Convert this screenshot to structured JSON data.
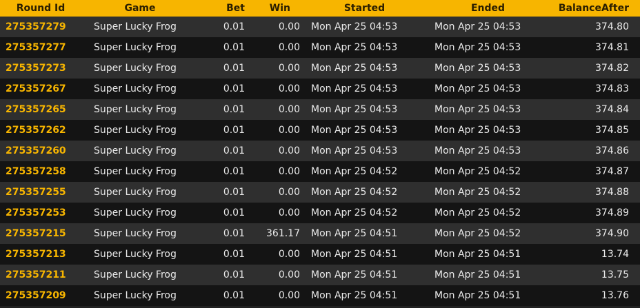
{
  "headers": {
    "round_id": "Round Id",
    "game": "Game",
    "bet": "Bet",
    "win": "Win",
    "started": "Started",
    "ended": "Ended",
    "balance_after": "BalanceAfter"
  },
  "colors": {
    "header_bg": "#f7b500",
    "round_id_text": "#f7b500",
    "row_light": "#2f2f2f",
    "row_dark": "#141414",
    "text": "#eaeaea"
  },
  "rows": [
    {
      "round_id": "275357279",
      "game": "Super Lucky Frog",
      "bet": "0.01",
      "win": "0.00",
      "started": "Mon Apr 25 04:53",
      "ended": "Mon Apr 25 04:53",
      "balance_after": "374.80"
    },
    {
      "round_id": "275357277",
      "game": "Super Lucky Frog",
      "bet": "0.01",
      "win": "0.00",
      "started": "Mon Apr 25 04:53",
      "ended": "Mon Apr 25 04:53",
      "balance_after": "374.81"
    },
    {
      "round_id": "275357273",
      "game": "Super Lucky Frog",
      "bet": "0.01",
      "win": "0.00",
      "started": "Mon Apr 25 04:53",
      "ended": "Mon Apr 25 04:53",
      "balance_after": "374.82"
    },
    {
      "round_id": "275357267",
      "game": "Super Lucky Frog",
      "bet": "0.01",
      "win": "0.00",
      "started": "Mon Apr 25 04:53",
      "ended": "Mon Apr 25 04:53",
      "balance_after": "374.83"
    },
    {
      "round_id": "275357265",
      "game": "Super Lucky Frog",
      "bet": "0.01",
      "win": "0.00",
      "started": "Mon Apr 25 04:53",
      "ended": "Mon Apr 25 04:53",
      "balance_after": "374.84"
    },
    {
      "round_id": "275357262",
      "game": "Super Lucky Frog",
      "bet": "0.01",
      "win": "0.00",
      "started": "Mon Apr 25 04:53",
      "ended": "Mon Apr 25 04:53",
      "balance_after": "374.85"
    },
    {
      "round_id": "275357260",
      "game": "Super Lucky Frog",
      "bet": "0.01",
      "win": "0.00",
      "started": "Mon Apr 25 04:53",
      "ended": "Mon Apr 25 04:53",
      "balance_after": "374.86"
    },
    {
      "round_id": "275357258",
      "game": "Super Lucky Frog",
      "bet": "0.01",
      "win": "0.00",
      "started": "Mon Apr 25 04:52",
      "ended": "Mon Apr 25 04:52",
      "balance_after": "374.87"
    },
    {
      "round_id": "275357255",
      "game": "Super Lucky Frog",
      "bet": "0.01",
      "win": "0.00",
      "started": "Mon Apr 25 04:52",
      "ended": "Mon Apr 25 04:52",
      "balance_after": "374.88"
    },
    {
      "round_id": "275357253",
      "game": "Super Lucky Frog",
      "bet": "0.01",
      "win": "0.00",
      "started": "Mon Apr 25 04:52",
      "ended": "Mon Apr 25 04:52",
      "balance_after": "374.89"
    },
    {
      "round_id": "275357215",
      "game": "Super Lucky Frog",
      "bet": "0.01",
      "win": "361.17",
      "started": "Mon Apr 25 04:51",
      "ended": "Mon Apr 25 04:52",
      "balance_after": "374.90"
    },
    {
      "round_id": "275357213",
      "game": "Super Lucky Frog",
      "bet": "0.01",
      "win": "0.00",
      "started": "Mon Apr 25 04:51",
      "ended": "Mon Apr 25 04:51",
      "balance_after": "13.74"
    },
    {
      "round_id": "275357211",
      "game": "Super Lucky Frog",
      "bet": "0.01",
      "win": "0.00",
      "started": "Mon Apr 25 04:51",
      "ended": "Mon Apr 25 04:51",
      "balance_after": "13.75"
    },
    {
      "round_id": "275357209",
      "game": "Super Lucky Frog",
      "bet": "0.01",
      "win": "0.00",
      "started": "Mon Apr 25 04:51",
      "ended": "Mon Apr 25 04:51",
      "balance_after": "13.76"
    }
  ]
}
